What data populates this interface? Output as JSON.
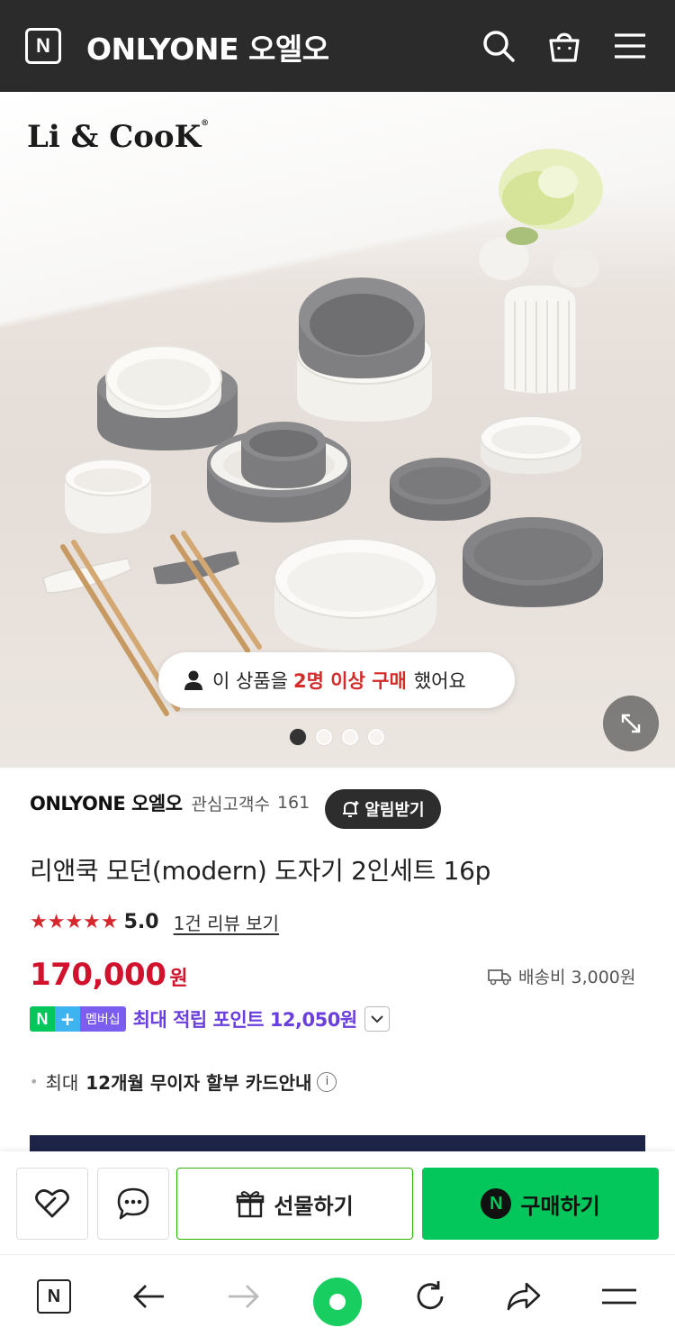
{
  "header": {
    "logo_letter": "N",
    "store_title": "ONLYONE 오엘오",
    "icons": [
      "search-icon",
      "shopping-bag-icon",
      "menu-icon"
    ],
    "background_color": "#2b2b2b"
  },
  "hero": {
    "brand_logo": "Li & CooK",
    "brand_logo_mark": "®",
    "purchase_notice": {
      "prefix": "이 상품을",
      "highlight": "2명 이상 구매",
      "suffix": "했어요",
      "highlight_color": "#d42a2a"
    },
    "slides": {
      "total": 4,
      "active": 1
    },
    "zoom_icon": "expand-icon"
  },
  "product": {
    "seller_name": "ONLYONE 오엘오",
    "favorite_label": "관심고객수",
    "favorite_count": "161",
    "alert_button": "알림받기",
    "title": "리앤쿡 모던(modern) 도자기 2인세트 16p",
    "rating": {
      "stars": "★★★★★",
      "value": "5.0",
      "review_link": "1건 리뷰 보기",
      "star_color": "#d6262e"
    },
    "price": {
      "amount": "170,000",
      "unit": "원",
      "color": "#d1122c"
    },
    "shipping": "배송비 3,000원",
    "membership": {
      "badge_n": "N",
      "badge_plus": "+",
      "badge_label": "멤버십",
      "points_text": "최대 적립 포인트 12,050원",
      "points_color": "#6a3fde"
    },
    "installment": {
      "bullet": "•",
      "prefix": "최대",
      "bold": "12개월 무이자 할부 카드안내",
      "info_icon": "i"
    }
  },
  "action_bar": {
    "like_icon": "heart-icon",
    "talk_icon": "chat-icon",
    "gift_label": "선물하기",
    "buy_label": "구매하기",
    "buy_badge": "N",
    "buy_color": "#03c75a"
  },
  "browser_nav": {
    "home_letter": "N",
    "icons": [
      "naver-home-icon",
      "back-arrow-icon",
      "forward-arrow-icon",
      "green-dot-icon",
      "refresh-icon",
      "share-icon",
      "menu-icon"
    ]
  }
}
